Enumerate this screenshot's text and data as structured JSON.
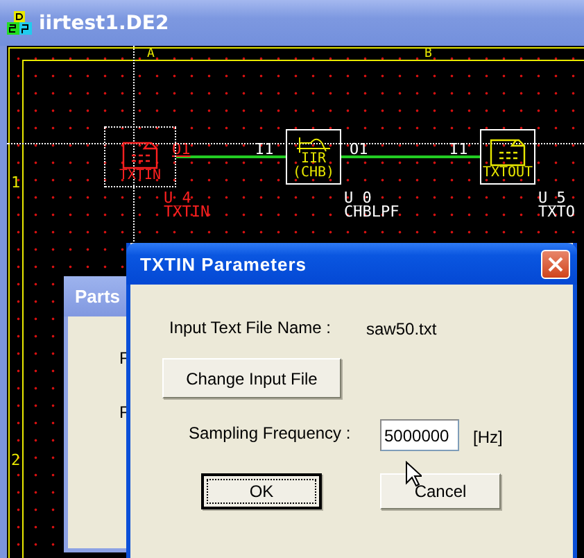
{
  "window": {
    "title": "iirtest1.DE2"
  },
  "canvas": {
    "column_labels": [
      "A",
      "B"
    ],
    "row_labels": [
      "1",
      "2"
    ],
    "blocks": [
      {
        "kind": "text-in",
        "selected": true,
        "caption": [
          "TXTIN"
        ],
        "ref": "U_4",
        "type": "TXTIN"
      },
      {
        "kind": "filter",
        "selected": false,
        "caption": [
          "IIR",
          "(CHB)"
        ],
        "ref": "U_0",
        "type": "CHBLPF"
      },
      {
        "kind": "text-out",
        "selected": false,
        "caption": [
          "TXTOUT"
        ],
        "ref": "U_5",
        "type": "TXTO"
      }
    ],
    "wires": [
      {
        "out": "O1",
        "in": "I1"
      },
      {
        "out": "O1",
        "in": "I1"
      }
    ]
  },
  "parts_dialog": {
    "title": "Parts",
    "labels": [
      "F",
      "F"
    ]
  },
  "params_dialog": {
    "title": "TXTIN Parameters",
    "file_label": "Input Text File Name :",
    "file_name": "saw50.txt",
    "change_button": "Change Input File",
    "rate_label": "Sampling Frequency :",
    "rate_value": "5000000",
    "rate_unit": "[Hz]",
    "buttons": [
      {
        "label": "OK",
        "default": true
      },
      {
        "label": "Cancel",
        "default": false
      }
    ]
  }
}
